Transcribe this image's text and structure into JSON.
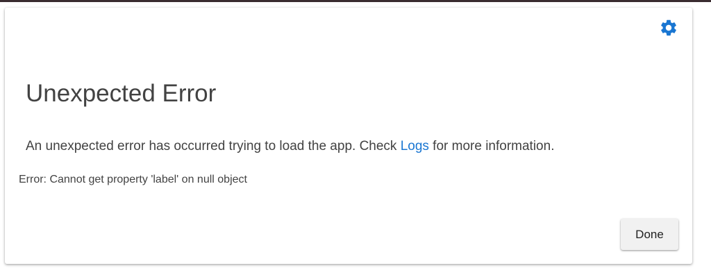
{
  "colors": {
    "accent": "#1976d2",
    "text": "#424242",
    "top_bar": "#3a2c30",
    "button_bg": "#f1f1f1"
  },
  "header": {
    "settings_icon": "gear-icon"
  },
  "dialog": {
    "title": "Unexpected Error",
    "message_before": "An unexpected error has occurred trying to load the app. Check ",
    "logs_link": "Logs",
    "message_after": " for more information.",
    "error_detail": "Error: Cannot get property 'label' on null object",
    "done_label": "Done"
  }
}
